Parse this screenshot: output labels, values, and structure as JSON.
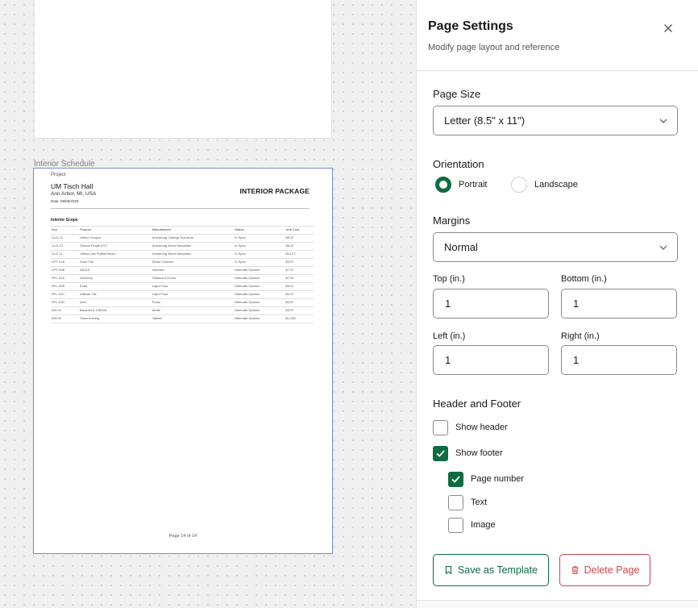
{
  "canvas": {
    "page_label": "Interior Schedule",
    "document": {
      "project_label": "Project",
      "project_name": "UM Tisch Hall",
      "location": "Ann Arbor, MI, USA",
      "date": "Date: 08/05/2026",
      "title": "INTERIOR PACKAGE",
      "section_title": "Interior Scope",
      "table_headers": [
        "Key",
        "Product",
        "Manufacturer",
        "Status",
        "Unit Cost"
      ],
      "table_rows": [
        [
          "CLG-10",
          "Ultima Coupon",
          "Armstrong Ceilings Solutions",
          "In Spec",
          "$5.57"
        ],
        [
          "CLG-12",
          "Tectum Finyte ETC",
          "Armstrong World Industries",
          "In Spec",
          "$5.57"
        ],
        [
          "CLG-11",
          "Ultima Low Profile/Vector",
          "Armstrong World Industries",
          "In Spec",
          "$12.57"
        ],
        [
          "CPT-01A",
          "Dune Tile",
          "Shaw Contract",
          "In Spec",
          "$3.57"
        ],
        [
          "CPT-02B",
          "AE315",
          "Interface",
          "Alternate Options",
          "$7.57"
        ],
        [
          "RFL-01A",
          "Kennedy",
          "Hartwood Floors",
          "Alternate Options",
          "$7.04"
        ],
        [
          "RFL-01B",
          "Eclat",
          "Lapis Floor",
          "Alternate Options",
          "$5.57"
        ],
        [
          "RFL-01C",
          "Altitude Tile",
          "Lapis Floor",
          "Alternate Options",
          "$5.57"
        ],
        [
          "RFL-01D",
          "Aero",
          "Forbo",
          "Alternate Options",
          "$5.57"
        ],
        [
          "WD-01",
          "Brushed II-135348",
          "Wolfe",
          "Alternate Options",
          "$3.57"
        ],
        [
          "WD-02",
          "Show Inching",
          "Tarkett",
          "Alternate Options",
          "$1,034"
        ]
      ],
      "footer": "Page 14 of 14"
    }
  },
  "panel": {
    "title": "Page Settings",
    "subtitle": "Modify page layout and reference",
    "page_size": {
      "label": "Page Size",
      "value": "Letter (8.5\" x 11\")"
    },
    "orientation": {
      "label": "Orientation",
      "options": [
        "Portrait",
        "Landscape"
      ],
      "selected": "Portrait"
    },
    "margins": {
      "label": "Margins",
      "preset": "Normal",
      "top_label": "Top (in.)",
      "top_value": "1",
      "bottom_label": "Bottom (in.)",
      "bottom_value": "1",
      "left_label": "Left (in.)",
      "left_value": "1",
      "right_label": "Right (in.)",
      "right_value": "1"
    },
    "header_footer": {
      "label": "Header and Footer",
      "show_header": {
        "label": "Show header",
        "checked": false
      },
      "show_footer": {
        "label": "Show footer",
        "checked": true
      },
      "page_number": {
        "label": "Page number",
        "checked": true
      },
      "text": {
        "label": "Text",
        "checked": false
      },
      "image": {
        "label": "Image",
        "checked": false
      }
    },
    "buttons": {
      "save_template": "Save as Template",
      "delete_page": "Delete Page"
    },
    "colors": {
      "accent": "#0f6b42",
      "danger": "#d0454b",
      "selection": "#6c8fd1"
    }
  }
}
